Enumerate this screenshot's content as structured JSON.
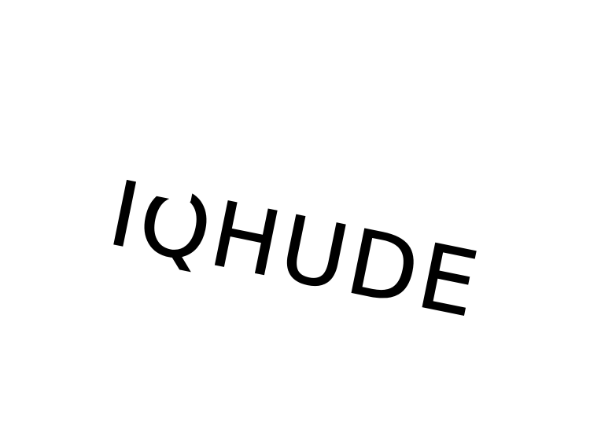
{
  "logo": {
    "text": "IQHUDE",
    "color": "#000000",
    "background": "#ffffff"
  }
}
